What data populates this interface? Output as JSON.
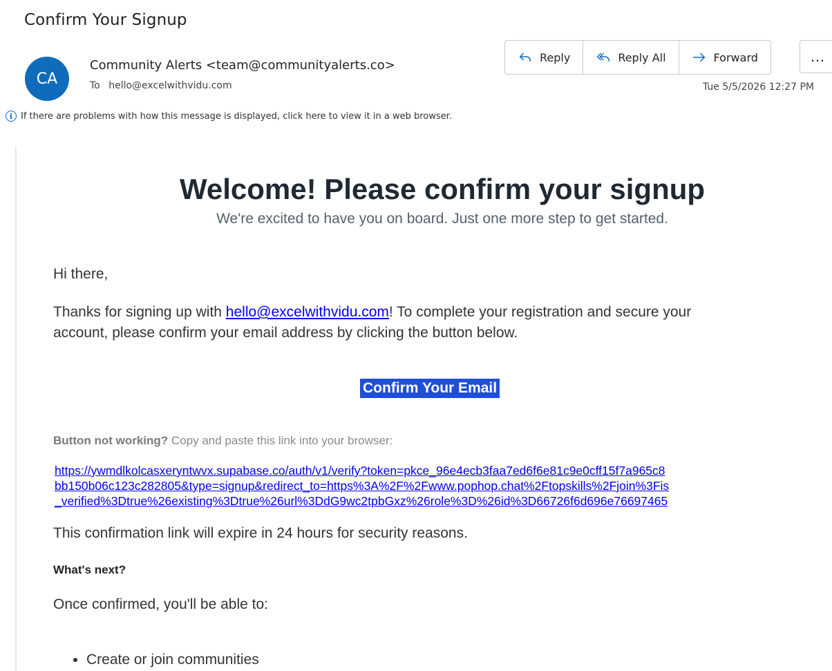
{
  "email": {
    "subject": "Confirm Your Signup",
    "avatar_initials": "CA",
    "sender": "Community Alerts <team@communityalerts.co>",
    "to_label": "To",
    "recipient": "hello@excelwithvidu.com",
    "date": "Tue 5/5/2026 12:27 PM",
    "info_text": "If there are problems with how this message is displayed, click here to view it in a web browser.",
    "actions": {
      "reply": "Reply",
      "reply_all": "Reply All",
      "forward": "Forward",
      "more": "…"
    }
  },
  "body": {
    "headline": "Welcome! Please confirm your signup",
    "subheadline": "We're excited to have you on board. Just one more step to get started.",
    "greeting": "Hi there,",
    "intro_before": "Thanks for signing up with ",
    "intro_link": "hello@excelwithvidu.com",
    "intro_after": "! To complete your registration and secure your",
    "intro_line2": "account, please confirm your email address by clicking the button below.",
    "confirm_button": "Confirm Your Email",
    "not_working_bold": "Button not working?",
    "not_working_text": " Copy and paste this link into your browser:",
    "verify_link_line1": "https://ywmdlkolcasxeryntwvx.supabase.co/auth/v1/verify?token=pkce_96e4ecb3faa7ed6f6e81c9e0cff15f7a965c8",
    "verify_link_line2": "bb150b06c123c282805&type=signup&redirect_to=https%3A%2F%2Fwww.pophop.chat%2Ftopskills%2Fjoin%3Fis",
    "verify_link_line3": "_verified%3Dtrue%26existing%3Dtrue%26url%3DdG9wc2tpbGxz%26role%3D%26id%3D66726f6d696e76697465",
    "expiry_note": "This confirmation link will expire in 24 hours for security reasons.",
    "whats_next": "What's next?",
    "once_confirmed": "Once confirmed, you'll be able to:",
    "bullets": [
      "Create or join communities"
    ]
  }
}
